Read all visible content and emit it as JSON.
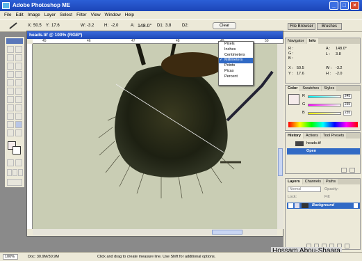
{
  "window": {
    "title": "Adobe Photoshop ME",
    "min": "_",
    "max": "□",
    "close": "×"
  },
  "menu": [
    "File",
    "Edit",
    "Image",
    "Layer",
    "Select",
    "Filter",
    "View",
    "Window",
    "Help"
  ],
  "options": {
    "x_label": "X:",
    "x_value": "50.5",
    "y_label": "Y:",
    "y_value": "17.6",
    "w_label": "W:",
    "w_value": "-3.2",
    "h_label": "H:",
    "h_value": "-2.0",
    "a_label": "A:",
    "a_value": "148.0°",
    "d1_label": "D1:",
    "d1_value": "3.8",
    "d2_label": "D2:",
    "clear_label": "Clear",
    "file_browser": "File Browser",
    "brushes": "Brushes"
  },
  "document": {
    "title": "heads.tif @ 100% (RGB*)",
    "ruler_marks": [
      "45",
      "46",
      "47",
      "48",
      "49",
      "50"
    ]
  },
  "unit_menu": {
    "items": [
      "Pixels",
      "Inches",
      "Centimeters",
      "Millimeters",
      "Points",
      "Picas",
      "Percent"
    ],
    "selected_index": 3,
    "check": "✓"
  },
  "navigator": {
    "tabs": [
      "Navigator",
      "Info"
    ],
    "r": "R :",
    "g": "G :",
    "b": "B :",
    "a_label": "A :",
    "a_value": "148.0°",
    "l_label": "L :",
    "l_value": "3.8",
    "x_label": "X :",
    "x_value": "50.5",
    "y_label": "Y :",
    "y_value": "17.6",
    "w_label": "W :",
    "w_value": "-3.2",
    "h_label": "H :",
    "h_value": "-2.0"
  },
  "color": {
    "tabs": [
      "Color",
      "Swatches",
      "Styles"
    ],
    "r": "R",
    "g": "G",
    "b": "B",
    "r_value": "245",
    "g_value": "235",
    "b_value": "235"
  },
  "history": {
    "tabs": [
      "History",
      "Actions",
      "Tool Presets"
    ],
    "snapshot": "heads.tif",
    "step": "Open"
  },
  "layers": {
    "tabs": [
      "Layers",
      "Channels",
      "Paths"
    ],
    "blend": "Normal",
    "opacity_label": "Opacity:",
    "lock_label": "Lock:",
    "fill_label": "Fill:",
    "background": "Background"
  },
  "status": {
    "zoom": "100%",
    "doc": "Doc: 30.9M/30.9M",
    "hint": "Click and drag to create measure line. Use Shift for additional options."
  },
  "credit": "Hossam Abou-Shaara"
}
